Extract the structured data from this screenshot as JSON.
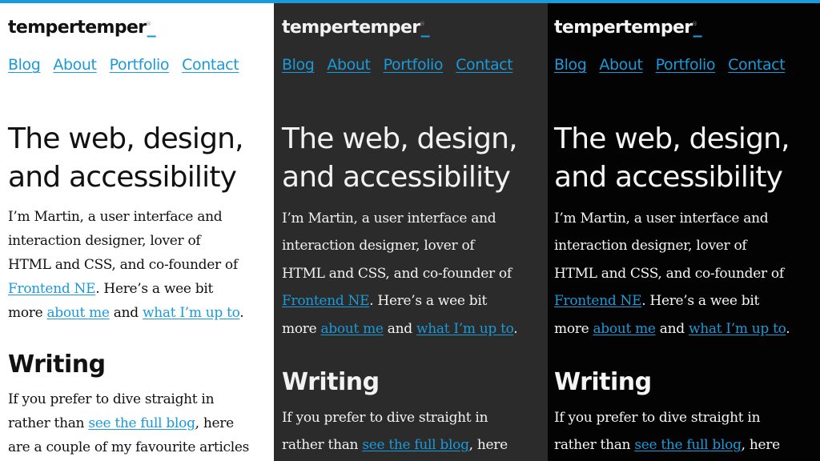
{
  "site": {
    "logo_text": "tempertemper",
    "logo_cursor": "_",
    "logo_mark": "®",
    "accent_color": "#1a9ad9"
  },
  "nav": {
    "items": [
      {
        "label": "Blog"
      },
      {
        "label": "About"
      },
      {
        "label": "Portfolio"
      },
      {
        "label": "Contact"
      }
    ]
  },
  "hero": {
    "line1": "The web, design,",
    "line2": "and accessibility"
  },
  "intro": {
    "l1": "I’m Martin, a user interface and",
    "l2": "interaction designer, lover of",
    "l3": "HTML and CSS, and co-founder of",
    "l4_link": "Frontend NE",
    "l4_text": ". Here’s a wee bit",
    "l5_pre": "more ",
    "l5_link1": "about me",
    "l5_mid": " and ",
    "l5_link2": "what I’m up to",
    "l5_end": "."
  },
  "writing": {
    "heading": "Writing",
    "l1": "If you prefer to dive straight in",
    "l2_pre": "rather than ",
    "l2_link": "see the full blog",
    "l2_post": ", here",
    "l3": "are a couple of my favourite articles"
  },
  "themes": [
    {
      "name": "light",
      "background": "#ffffff",
      "text": "#111111"
    },
    {
      "name": "dark",
      "background": "#2b2b2b",
      "text": "#f2f2f2"
    },
    {
      "name": "black",
      "background": "#030303",
      "text": "#f5f5f5"
    }
  ]
}
